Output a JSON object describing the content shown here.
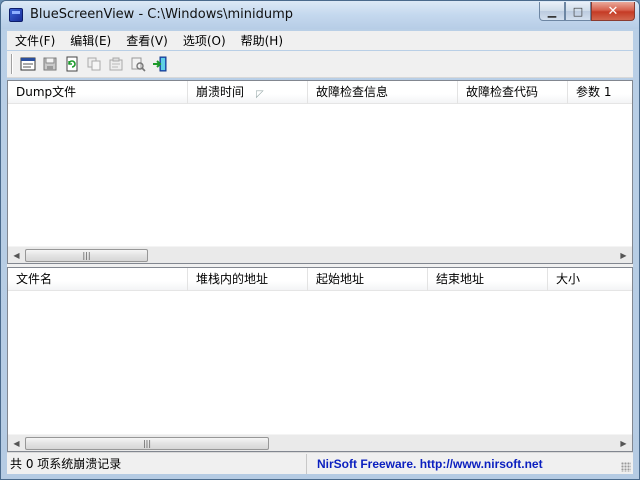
{
  "window": {
    "title": "BlueScreenView  -  C:\\Windows\\minidump",
    "controls": {
      "minimize": "▁",
      "maximize": "□",
      "close": "✕"
    }
  },
  "menu": [
    {
      "label": "文件(F)"
    },
    {
      "label": "编辑(E)"
    },
    {
      "label": "查看(V)"
    },
    {
      "label": "选项(O)"
    },
    {
      "label": "帮助(H)"
    }
  ],
  "toolbar": [
    {
      "icon": "html-report-icon"
    },
    {
      "icon": "save-icon"
    },
    {
      "icon": "refresh-icon"
    },
    {
      "icon": "copy-icon"
    },
    {
      "icon": "properties-icon"
    },
    {
      "icon": "find-icon"
    },
    {
      "icon": "exit-icon"
    }
  ],
  "upper_table": {
    "columns": [
      "Dump文件",
      "崩溃时间",
      "故障检查信息",
      "故障检查代码",
      "参数 1"
    ],
    "sort_indicator": "◸",
    "scroll_thumb_grip": "|||"
  },
  "lower_table": {
    "columns": [
      "文件名",
      "堆栈内的地址",
      "起始地址",
      "结束地址",
      "大小"
    ],
    "scroll_thumb_grip": "|||"
  },
  "scroll": {
    "left_arrow": "◀",
    "right_arrow": "▶"
  },
  "status": {
    "left": "共 0 项系统崩溃记录",
    "right": "NirSoft Freeware.  http://www.nirsoft.net"
  }
}
